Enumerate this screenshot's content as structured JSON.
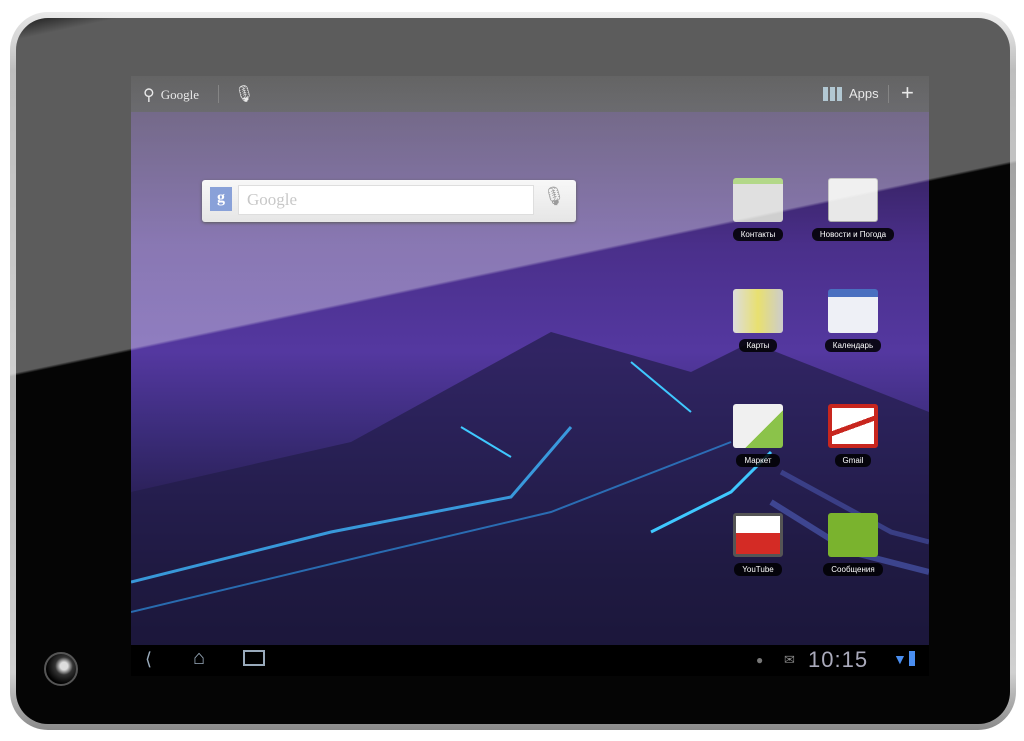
{
  "topbar": {
    "search_label": "Google",
    "apps_label": "Apps",
    "icons": [
      "search-icon",
      "mic-icon",
      "apps-grid-icon",
      "plus-icon"
    ]
  },
  "search_widget": {
    "logo": "g",
    "placeholder": "Google"
  },
  "apps": [
    {
      "label": "Контакты",
      "color": "#cfcfcf"
    },
    {
      "label": "Новости и Погода",
      "color": "#e8e8e8"
    },
    {
      "label": "Карты",
      "color": "#d8d4b0"
    },
    {
      "label": "Календарь",
      "color": "#eef0f6"
    },
    {
      "label": "Маркет",
      "color": "#e0e0e0"
    },
    {
      "label": "Gmail",
      "color": "#c8261e"
    },
    {
      "label": "YouTube",
      "color": "#d42b25"
    },
    {
      "label": "Сообщения",
      "color": "#7ab32e"
    }
  ],
  "statusbar": {
    "time": "10:15",
    "icons": [
      "back-icon",
      "home-icon",
      "recent-apps-icon",
      "android-debug-icon",
      "mail-icon",
      "wifi-icon",
      "battery-icon"
    ]
  }
}
